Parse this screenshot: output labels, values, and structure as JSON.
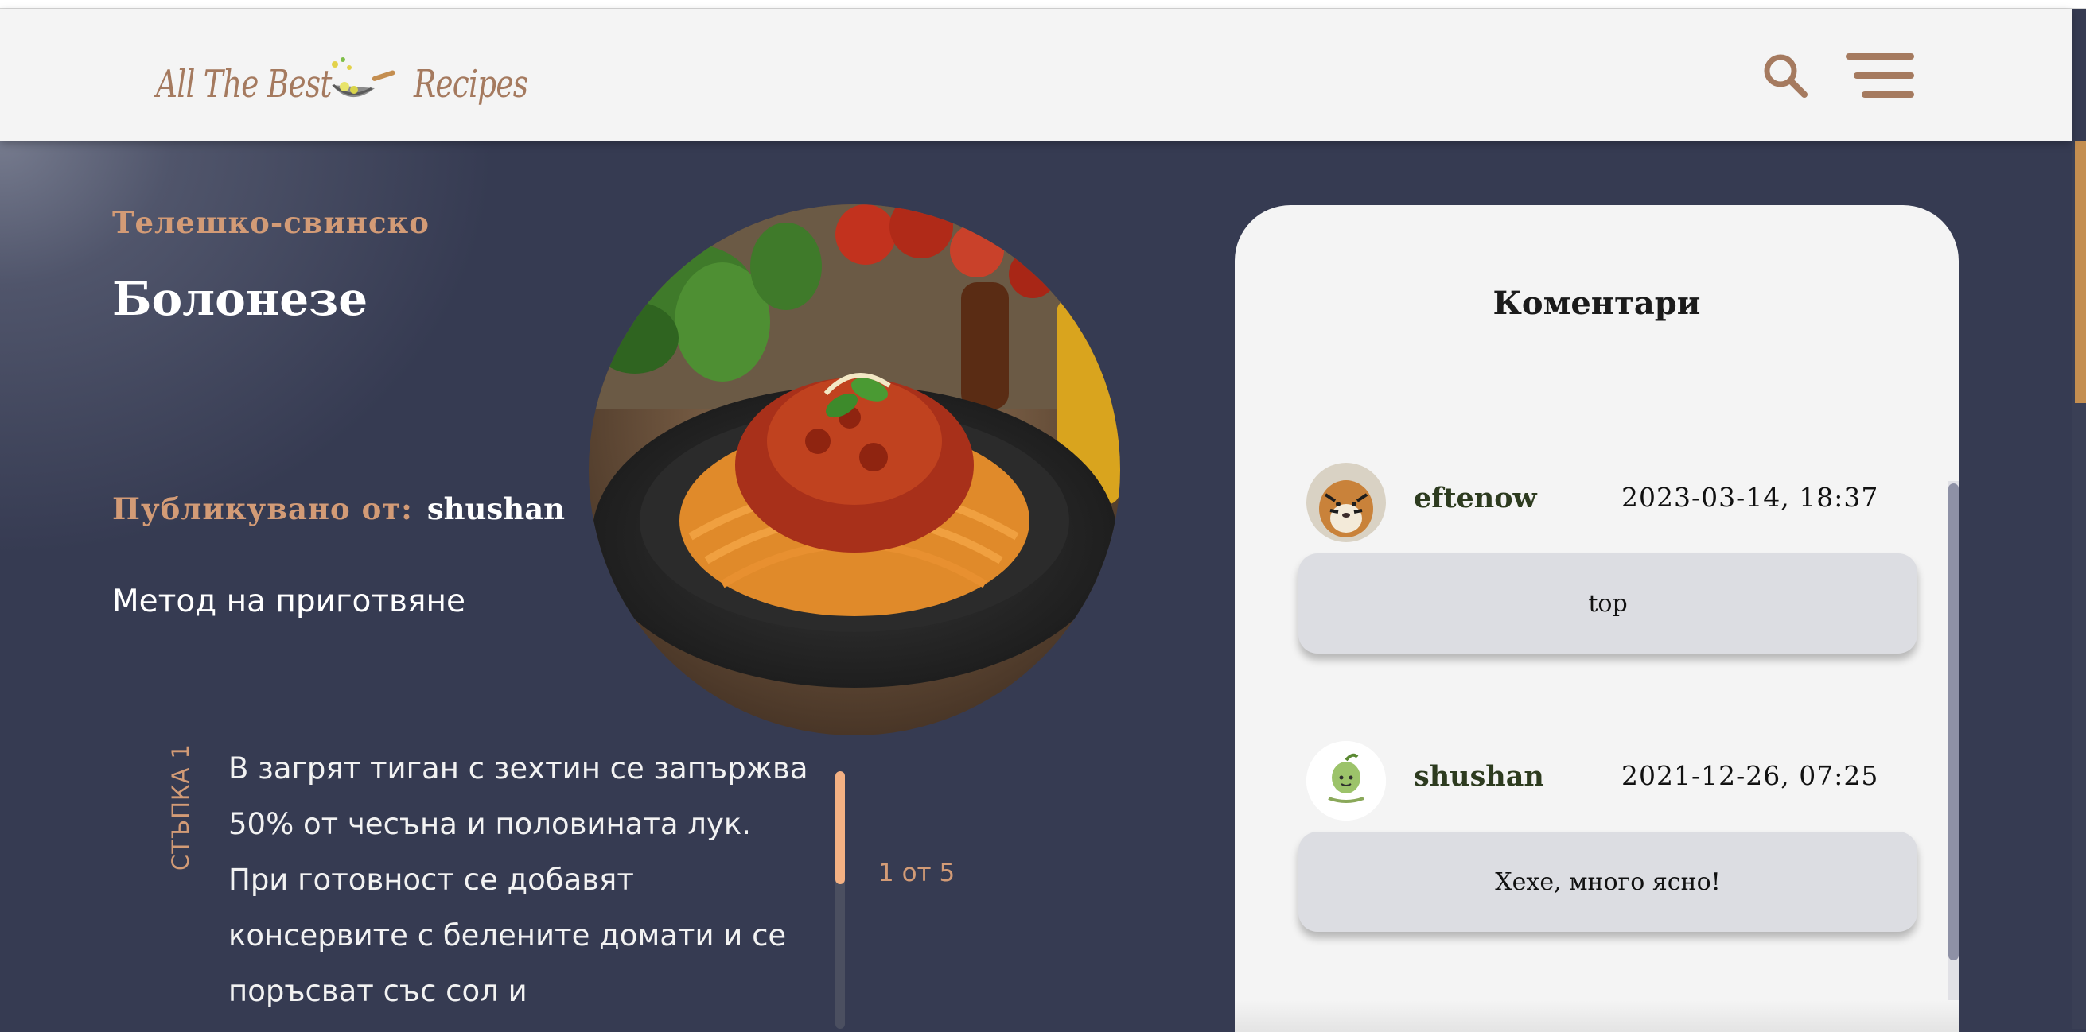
{
  "header": {
    "logo_word1": "All The Best",
    "logo_word2": "Recipes",
    "search_icon": "search-icon",
    "menu_icon": "hamburger-menu-icon"
  },
  "recipe": {
    "category": "Телешко-свинско",
    "title": "Болонезе",
    "published_label": "Публикувано от:",
    "author": "shushan",
    "method_title": "Метод на приготвяне",
    "step_label": "СТЪПКА 1",
    "step_text": "В загрят тиган с зехтин се запържва 50% от чесъна и половината лук. При готовност се добавят консервите с белените домати и се поръсват със сол и",
    "step_counter": "1 от 5",
    "step_progress": 0.2
  },
  "comments": {
    "title": "Коментари",
    "items": [
      {
        "user": "eftenow",
        "date": "2023-03-14, 18:37",
        "text": "top",
        "avatar": "tiger-avatar"
      },
      {
        "user": "shushan",
        "date": "2021-12-26, 07:25",
        "text": "Хехе, много ясно!",
        "avatar": "shushan-avatar"
      }
    ]
  },
  "colors": {
    "accent": "#a57a5f",
    "background": "#363b52",
    "label": "#d39b76",
    "panel": "#f4f4f4"
  }
}
